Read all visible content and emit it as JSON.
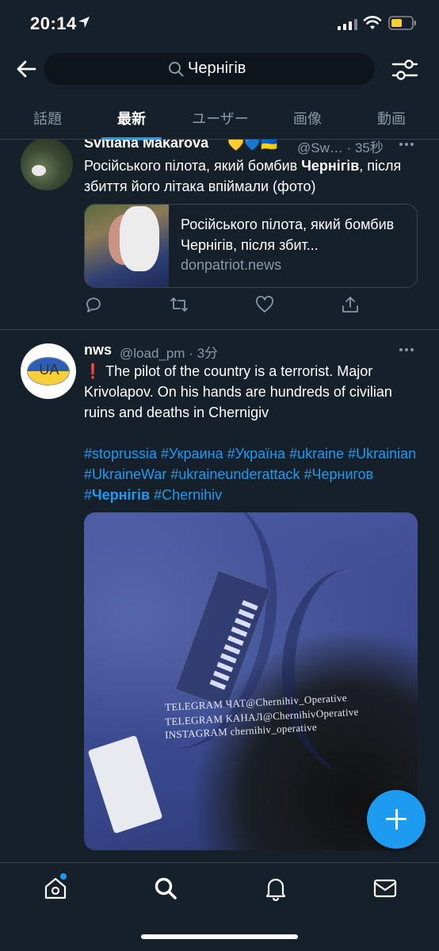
{
  "status_bar": {
    "time": "20:14"
  },
  "search": {
    "query": "Чернігів"
  },
  "tabs": [
    {
      "label": "話題"
    },
    {
      "label": "最新"
    },
    {
      "label": "ユーザー"
    },
    {
      "label": "画像"
    },
    {
      "label": "動画"
    }
  ],
  "active_tab": "最新",
  "tweets": [
    {
      "name": "Svitlana Makarova",
      "badges": "💛💙🇺🇦",
      "handle_time": "@Sw… · 35秒",
      "text_before": "Російського пілота, який бомбив ",
      "text_bold": "Чернігів",
      "text_after": ", після збиття його літака впіймали (фото)",
      "card": {
        "title": "Російського пілота, який бомбив Чернігів, після збит...",
        "site": "donpatriot.news"
      }
    },
    {
      "name": "nws",
      "handle_time": "@load_pm · 3分",
      "avatar_text": "UA",
      "text_icon": "❗",
      "text": " The pilot of the country is a terrorist. Major Krivolapov. On his hands are hundreds of civilian ruins and deaths in Chernigiv",
      "hashtags_before": "#stoprussia #Украина #Україна #ukraine #Ukrainian #UkraineWar #ukraineunderattack #Чернигов #",
      "hashtags_bold": "Чернігів",
      "hashtags_after": " #Chernihiv",
      "media_watermark": [
        "TELEGRAM ЧАТ@Chernihiv_Operative",
        "TELEGRAM КАНАЛ@ChernihivOperative",
        "INSTAGRAM    chernihiv_operative"
      ]
    }
  ],
  "colors": {
    "accent": "#1d9bf0",
    "background": "#15202b",
    "muted": "#8b98a5",
    "border": "#38444d"
  }
}
